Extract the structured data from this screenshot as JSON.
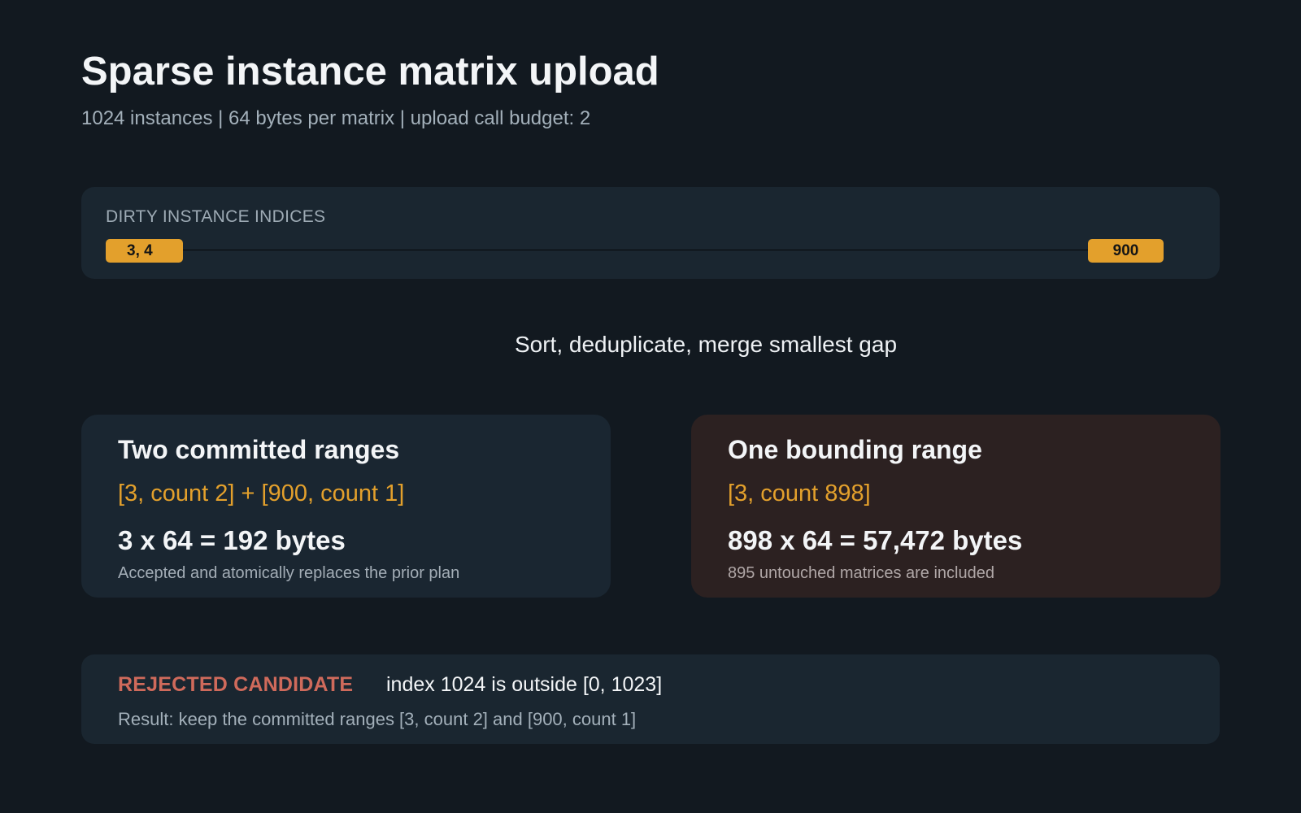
{
  "header": {
    "title": "Sparse instance matrix upload",
    "subtitle": "1024 instances | 64 bytes per matrix | upload call budget: 2"
  },
  "dirty_indices": {
    "label": "DIRTY INSTANCE INDICES",
    "chips": [
      "3, 4",
      "900"
    ]
  },
  "step": {
    "label": "Sort, deduplicate, merge smallest gap"
  },
  "committed": {
    "title": "Two committed ranges",
    "ranges": "[3, count 2] + [900, count 1]",
    "math": "3 x 64 = 192 bytes",
    "note": "Accepted and atomically replaces the prior plan"
  },
  "bounding": {
    "title": "One bounding range",
    "ranges": "[3, count 898]",
    "math": "898 x 64 = 57,472 bytes",
    "note": "895 untouched matrices are included"
  },
  "rejected": {
    "label": "REJECTED CANDIDATE",
    "message": "index 1024 is outside [0, 1023]",
    "result": "Result: keep the committed ranges [3, count 2] and [900, count 1]"
  },
  "colors": {
    "background": "#121920",
    "panel": "#1a2630",
    "accent": "#e3a02c",
    "warning_card": "#2c2121",
    "reject": "#cf6a5b"
  }
}
